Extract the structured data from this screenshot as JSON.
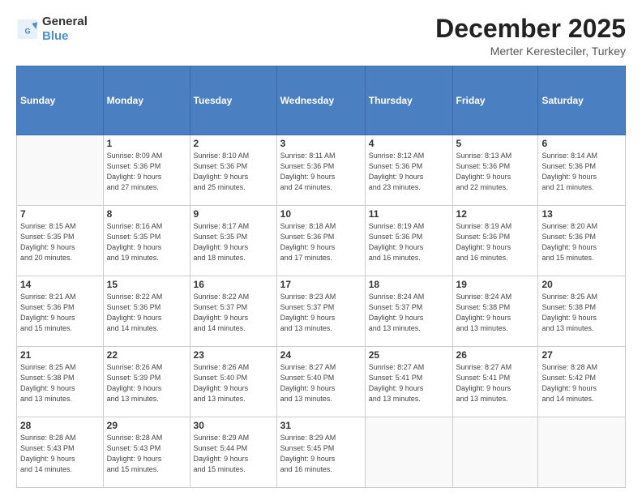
{
  "header": {
    "logo_line1": "General",
    "logo_line2": "Blue",
    "month": "December 2025",
    "location": "Merter Keresteciler, Turkey"
  },
  "weekdays": [
    "Sunday",
    "Monday",
    "Tuesday",
    "Wednesday",
    "Thursday",
    "Friday",
    "Saturday"
  ],
  "weeks": [
    [
      {
        "day": "",
        "info": ""
      },
      {
        "day": "1",
        "info": "Sunrise: 8:09 AM\nSunset: 5:36 PM\nDaylight: 9 hours\nand 27 minutes."
      },
      {
        "day": "2",
        "info": "Sunrise: 8:10 AM\nSunset: 5:36 PM\nDaylight: 9 hours\nand 25 minutes."
      },
      {
        "day": "3",
        "info": "Sunrise: 8:11 AM\nSunset: 5:36 PM\nDaylight: 9 hours\nand 24 minutes."
      },
      {
        "day": "4",
        "info": "Sunrise: 8:12 AM\nSunset: 5:36 PM\nDaylight: 9 hours\nand 23 minutes."
      },
      {
        "day": "5",
        "info": "Sunrise: 8:13 AM\nSunset: 5:36 PM\nDaylight: 9 hours\nand 22 minutes."
      },
      {
        "day": "6",
        "info": "Sunrise: 8:14 AM\nSunset: 5:36 PM\nDaylight: 9 hours\nand 21 minutes."
      }
    ],
    [
      {
        "day": "7",
        "info": "Sunrise: 8:15 AM\nSunset: 5:35 PM\nDaylight: 9 hours\nand 20 minutes."
      },
      {
        "day": "8",
        "info": "Sunrise: 8:16 AM\nSunset: 5:35 PM\nDaylight: 9 hours\nand 19 minutes."
      },
      {
        "day": "9",
        "info": "Sunrise: 8:17 AM\nSunset: 5:35 PM\nDaylight: 9 hours\nand 18 minutes."
      },
      {
        "day": "10",
        "info": "Sunrise: 8:18 AM\nSunset: 5:36 PM\nDaylight: 9 hours\nand 17 minutes."
      },
      {
        "day": "11",
        "info": "Sunrise: 8:19 AM\nSunset: 5:36 PM\nDaylight: 9 hours\nand 16 minutes."
      },
      {
        "day": "12",
        "info": "Sunrise: 8:19 AM\nSunset: 5:36 PM\nDaylight: 9 hours\nand 16 minutes."
      },
      {
        "day": "13",
        "info": "Sunrise: 8:20 AM\nSunset: 5:36 PM\nDaylight: 9 hours\nand 15 minutes."
      }
    ],
    [
      {
        "day": "14",
        "info": "Sunrise: 8:21 AM\nSunset: 5:36 PM\nDaylight: 9 hours\nand 15 minutes."
      },
      {
        "day": "15",
        "info": "Sunrise: 8:22 AM\nSunset: 5:36 PM\nDaylight: 9 hours\nand 14 minutes."
      },
      {
        "day": "16",
        "info": "Sunrise: 8:22 AM\nSunset: 5:37 PM\nDaylight: 9 hours\nand 14 minutes."
      },
      {
        "day": "17",
        "info": "Sunrise: 8:23 AM\nSunset: 5:37 PM\nDaylight: 9 hours\nand 13 minutes."
      },
      {
        "day": "18",
        "info": "Sunrise: 8:24 AM\nSunset: 5:37 PM\nDaylight: 9 hours\nand 13 minutes."
      },
      {
        "day": "19",
        "info": "Sunrise: 8:24 AM\nSunset: 5:38 PM\nDaylight: 9 hours\nand 13 minutes."
      },
      {
        "day": "20",
        "info": "Sunrise: 8:25 AM\nSunset: 5:38 PM\nDaylight: 9 hours\nand 13 minutes."
      }
    ],
    [
      {
        "day": "21",
        "info": "Sunrise: 8:25 AM\nSunset: 5:38 PM\nDaylight: 9 hours\nand 13 minutes."
      },
      {
        "day": "22",
        "info": "Sunrise: 8:26 AM\nSunset: 5:39 PM\nDaylight: 9 hours\nand 13 minutes."
      },
      {
        "day": "23",
        "info": "Sunrise: 8:26 AM\nSunset: 5:40 PM\nDaylight: 9 hours\nand 13 minutes."
      },
      {
        "day": "24",
        "info": "Sunrise: 8:27 AM\nSunset: 5:40 PM\nDaylight: 9 hours\nand 13 minutes."
      },
      {
        "day": "25",
        "info": "Sunrise: 8:27 AM\nSunset: 5:41 PM\nDaylight: 9 hours\nand 13 minutes."
      },
      {
        "day": "26",
        "info": "Sunrise: 8:27 AM\nSunset: 5:41 PM\nDaylight: 9 hours\nand 13 minutes."
      },
      {
        "day": "27",
        "info": "Sunrise: 8:28 AM\nSunset: 5:42 PM\nDaylight: 9 hours\nand 14 minutes."
      }
    ],
    [
      {
        "day": "28",
        "info": "Sunrise: 8:28 AM\nSunset: 5:43 PM\nDaylight: 9 hours\nand 14 minutes."
      },
      {
        "day": "29",
        "info": "Sunrise: 8:28 AM\nSunset: 5:43 PM\nDaylight: 9 hours\nand 15 minutes."
      },
      {
        "day": "30",
        "info": "Sunrise: 8:29 AM\nSunset: 5:44 PM\nDaylight: 9 hours\nand 15 minutes."
      },
      {
        "day": "31",
        "info": "Sunrise: 8:29 AM\nSunset: 5:45 PM\nDaylight: 9 hours\nand 16 minutes."
      },
      {
        "day": "",
        "info": ""
      },
      {
        "day": "",
        "info": ""
      },
      {
        "day": "",
        "info": ""
      }
    ]
  ]
}
